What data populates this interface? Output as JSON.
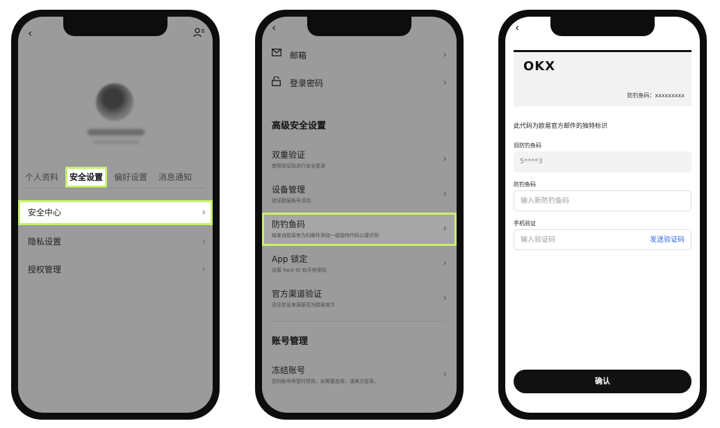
{
  "colors": {
    "highlight": "#c8f26a",
    "link": "#2c67d8",
    "button": "#111111"
  },
  "phone1": {
    "back_icon": "‹",
    "person_icon": "person-add-icon",
    "tabs": [
      "个人资料",
      "安全设置",
      "偏好设置",
      "消息通知"
    ],
    "rows": [
      "安全中心",
      "隐私设置",
      "授权管理"
    ]
  },
  "phone2": {
    "top_rows": [
      "邮箱",
      "登录密码"
    ],
    "section_advanced": "高级安全设置",
    "items": [
      {
        "title": "双重验证",
        "sub": "使用验证码进行安全登录"
      },
      {
        "title": "设备管理",
        "sub": "验证欧易账号活动"
      },
      {
        "title": "防钓鱼码",
        "sub": "结束自欧易官方的邮件添加一组独特代码以便识别"
      },
      {
        "title": "App 锁定",
        "sub": "设置 Face ID 和手势密码"
      },
      {
        "title": "官方渠道验证",
        "sub": "验证信息来源是否为欧易官方"
      }
    ],
    "section_account": "账号管理",
    "freeze": {
      "title": "冻结账号",
      "sub": "您的账号将暂时停用，如需要启用，请再次登录。"
    }
  },
  "phone3": {
    "logo": "OKX",
    "card_code": "防钓鱼码：xxxxxxxxx",
    "desc": "此代码为欧易官方邮件的独特标识",
    "old_label": "旧防钓鱼码",
    "old_value": "5****3",
    "new_label": "防钓鱼码",
    "new_placeholder": "输入新防钓鱼码",
    "phone_label": "手机验证",
    "code_placeholder": "输入验证码",
    "send_code": "发送验证码",
    "confirm": "确认"
  }
}
